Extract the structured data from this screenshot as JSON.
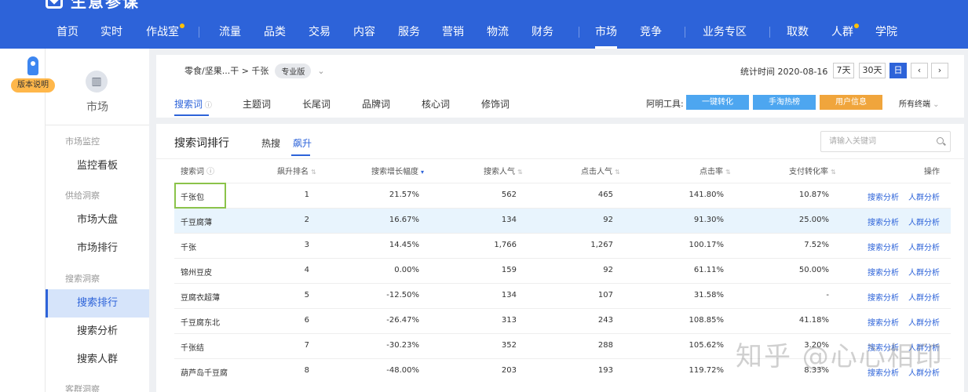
{
  "brand": {
    "name": "生意参谋"
  },
  "nav": [
    {
      "label": "首页"
    },
    {
      "label": "实时"
    },
    {
      "label": "作战室",
      "dot": true
    },
    {
      "label": "流量"
    },
    {
      "label": "品类"
    },
    {
      "label": "交易"
    },
    {
      "label": "内容"
    },
    {
      "label": "服务"
    },
    {
      "label": "营销"
    },
    {
      "label": "物流"
    },
    {
      "label": "财务"
    },
    {
      "label": "市场",
      "active": true
    },
    {
      "label": "竞争"
    },
    {
      "label": "业务专区"
    },
    {
      "label": "取数"
    },
    {
      "label": "人群",
      "dot": true
    },
    {
      "label": "学院"
    }
  ],
  "version_badge": "版本说明",
  "sidebar": {
    "head_label": "市场",
    "groups": [
      "市场监控",
      "供给洞察",
      "搜索洞察",
      "客群洞察"
    ],
    "items": [
      "监控看板",
      "市场大盘",
      "市场排行",
      "搜索排行",
      "搜索分析",
      "搜索人群"
    ]
  },
  "breadcrumb": {
    "path": "零食/坚果...干 > 千张",
    "tag": "专业版"
  },
  "stats": {
    "date_label": "统计时间 2020-08-16",
    "btn_7": "7天",
    "btn_30": "30天",
    "btn_day": "日",
    "prev": "‹",
    "next": "›"
  },
  "tabs": [
    "搜索词",
    "主题词",
    "长尾词",
    "品牌词",
    "核心词",
    "修饰词"
  ],
  "tools": {
    "label": "阿明工具:",
    "buttons": [
      {
        "label": "一键转化",
        "color": "#4da6f0"
      },
      {
        "label": "手淘热榜",
        "color": "#4da6f0"
      },
      {
        "label": "用户信息",
        "color": "#f0a53c"
      }
    ],
    "all_terminals": "所有终端"
  },
  "ranking": {
    "title": "搜索词排行",
    "subtabs": [
      "热搜",
      "飙升"
    ],
    "search_placeholder": "请输入关键词",
    "columns": [
      "搜索词",
      "飙升排名",
      "搜索增长幅度",
      "搜索人气",
      "点击人气",
      "点击率",
      "支付转化率",
      "操作"
    ],
    "rows": [
      {
        "kw": "千张包",
        "rank": "1",
        "growth": "21.57%",
        "pop": "562",
        "click": "465",
        "ctr": "141.80%",
        "conv": "10.87%"
      },
      {
        "kw": "千豆腐薄",
        "rank": "2",
        "growth": "16.67%",
        "pop": "134",
        "click": "92",
        "ctr": "91.30%",
        "conv": "25.00%"
      },
      {
        "kw": "千张",
        "rank": "3",
        "growth": "14.45%",
        "pop": "1,766",
        "click": "1,267",
        "ctr": "100.17%",
        "conv": "7.52%"
      },
      {
        "kw": "锦州豆皮",
        "rank": "4",
        "growth": "0.00%",
        "pop": "159",
        "click": "92",
        "ctr": "61.11%",
        "conv": "50.00%"
      },
      {
        "kw": "豆腐衣超薄",
        "rank": "5",
        "growth": "-12.50%",
        "pop": "134",
        "click": "107",
        "ctr": "31.58%",
        "conv": "-"
      },
      {
        "kw": "千豆腐东北",
        "rank": "6",
        "growth": "-26.47%",
        "pop": "313",
        "click": "243",
        "ctr": "108.85%",
        "conv": "41.18%"
      },
      {
        "kw": "千张结",
        "rank": "7",
        "growth": "-30.23%",
        "pop": "352",
        "click": "288",
        "ctr": "105.62%",
        "conv": "3.20%"
      },
      {
        "kw": "葫芦岛千豆腐",
        "rank": "8",
        "growth": "-48.00%",
        "pop": "203",
        "click": "193",
        "ctr": "119.72%",
        "conv": "8.33%"
      }
    ],
    "op_search": "搜索分析",
    "op_crowd": "人群分析"
  },
  "watermark": "知乎 @心心相印"
}
